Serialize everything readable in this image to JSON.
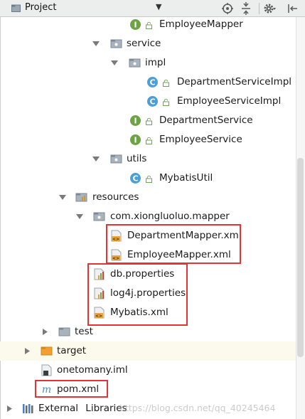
{
  "toolbar": {
    "title": "Project",
    "dropdown_glyph": "▼",
    "icons": [
      "target-icon",
      "collapse-all-icon",
      "gear-icon",
      "hide-panel-icon"
    ]
  },
  "tree": {
    "rows": [
      {
        "name": "EmployeeMapper",
        "kind": "interface",
        "expanded": null
      },
      {
        "name": "service",
        "kind": "package",
        "expanded": true
      },
      {
        "name": "impl",
        "kind": "package",
        "expanded": true
      },
      {
        "name": "DepartmentServiceImpl",
        "kind": "class",
        "expanded": null
      },
      {
        "name": "EmployeeServiceImpl",
        "kind": "class",
        "expanded": null
      },
      {
        "name": "DepartmentService",
        "kind": "interface",
        "expanded": null
      },
      {
        "name": "EmployeeService",
        "kind": "interface",
        "expanded": null
      },
      {
        "name": "utils",
        "kind": "package",
        "expanded": true
      },
      {
        "name": "MybatisUtil",
        "kind": "class",
        "expanded": null
      },
      {
        "name": "resources",
        "kind": "resources-folder",
        "expanded": true
      },
      {
        "name": "com.xiongluoluo.mapper",
        "kind": "package",
        "expanded": true
      },
      {
        "name": "DepartmentMapper.xml",
        "kind": "xml",
        "expanded": null
      },
      {
        "name": "EmployeeMapper.xml",
        "kind": "xml",
        "expanded": null
      },
      {
        "name": "db.properties",
        "kind": "properties",
        "expanded": null
      },
      {
        "name": "log4j.properties",
        "kind": "properties",
        "expanded": null
      },
      {
        "name": "Mybatis.xml",
        "kind": "xml",
        "expanded": null
      },
      {
        "name": "test",
        "kind": "folder",
        "expanded": false
      },
      {
        "name": "target",
        "kind": "excluded-folder",
        "expanded": false
      },
      {
        "name": "onetomany.iml",
        "kind": "iml",
        "expanded": null
      },
      {
        "name": "pom.xml",
        "kind": "maven",
        "expanded": null
      },
      {
        "name": "External Libraries",
        "kind": "libraries",
        "expanded": false
      }
    ]
  },
  "watermark": "https://blog.csdn.net/qq_40245464",
  "colors": {
    "annotation_box": "#e53333",
    "interface_icon": "#6ca345",
    "class_icon": "#4c9ed6",
    "lock_icon": "#6aa84f",
    "excluded_folder": "#f0a030",
    "highlight_row": "#fcfaed"
  }
}
